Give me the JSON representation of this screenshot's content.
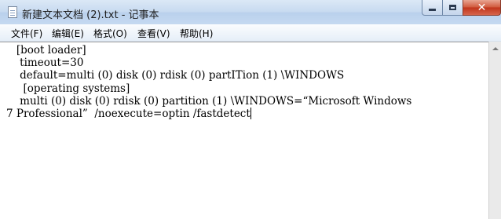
{
  "window": {
    "title": "新建文本文档 (2).txt - 记事本",
    "close_symbol": "✕"
  },
  "menu": {
    "items": [
      "文件(F)",
      "编辑(E)",
      "格式(O)",
      "查看(V)",
      "帮助(H)"
    ]
  },
  "editor": {
    "lines": [
      "   [boot loader]",
      "    timeout=30",
      "    default=multi (0) disk (0) rdisk (0) partITion (1) \\WINDOWS",
      "     [operating systems]",
      "    multi (0) disk (0) rdisk (0) partition (1) \\WINDOWS=“Microsoft Windows",
      "7 Professional”  /noexecute=optin /fastdetect"
    ]
  },
  "icons": [
    "notepad-app-icon",
    "minimize-icon",
    "maximize-icon",
    "close-icon",
    "scroll-up-arrow-icon"
  ]
}
